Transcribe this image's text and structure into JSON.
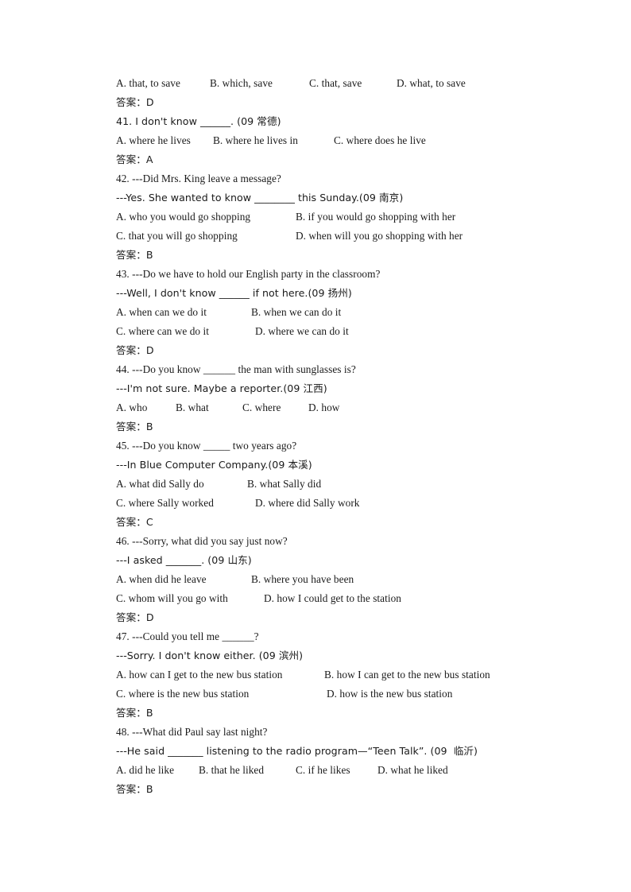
{
  "document": {
    "type": "english-grammar-worksheet",
    "answer_label": "答案：",
    "blank_short": "_____",
    "blank_medium": "______",
    "blank_long": "_______",
    "blank_xlong": "________"
  },
  "lead_options": {
    "a": "A. that, to save",
    "b": "B. which, save",
    "c": "C. that, save",
    "d": "D. what, to save",
    "answer": "答案：D"
  },
  "questions": [
    {
      "number": "41",
      "stem": "41. I don't know ______. (09 常德)",
      "stem_parts": {
        "prefix": "41. I don't know ",
        "blank": "______",
        "suffix": ". (09 常德)"
      },
      "sub_stem": null,
      "options_layout": "three-inline",
      "options": [
        "A. where he lives",
        "B. where he lives in",
        "C. where does he live"
      ],
      "answer": "答案：A"
    },
    {
      "number": "42",
      "stem": "42. ---Did Mrs. King leave a message?",
      "sub_stem": "---Yes. She wanted to know ________ this Sunday.(09 南京)",
      "sub_stem_parts": {
        "prefix": "---Yes. She wanted to know ",
        "blank": "________",
        "suffix": " this Sunday.(09 南京)"
      },
      "options_layout": "two-column-wide",
      "options": [
        "A. who you would go shopping",
        "B. if you would go shopping with her",
        "C. that you will go shopping",
        "D. when will you go shopping with her"
      ],
      "answer": "答案：B"
    },
    {
      "number": "43",
      "stem": "43. ---Do we have to hold our English party in the classroom?",
      "sub_stem": "---Well, I don't know ______ if not here.(09 扬州)",
      "sub_stem_parts": {
        "prefix": "---Well, I don't know ",
        "blank": "______",
        "suffix": " if not here.(09 扬州)"
      },
      "options_layout": "two-column-narrow",
      "options": [
        "A. when can we do it",
        "B. when we can do it",
        "C. where can we do it",
        "D. where we can do it"
      ],
      "answer": "答案：D"
    },
    {
      "number": "44",
      "stem": "44. ---Do you know ______ the man with sunglasses is?",
      "sub_stem": "---I'm not sure. Maybe a reporter.(09 江西)",
      "stem_parts": {
        "prefix": "44. ---Do you know ",
        "blank": "______",
        "suffix": " the man with sunglasses is?"
      },
      "options_layout": "four-inline",
      "options": [
        "A. who",
        "B. what",
        "C. where",
        "D. how"
      ],
      "answer": "答案：B"
    },
    {
      "number": "45",
      "stem": "45. ---Do you know _____ two years ago?",
      "sub_stem": "---In Blue Computer Company.(09 本溪)",
      "stem_parts": {
        "prefix": "45. ---Do you know ",
        "blank": "_____",
        "suffix": " two years ago?"
      },
      "options_layout": "two-column-narrow",
      "options": [
        "A. what did Sally do",
        "B. what Sally did",
        "C. where Sally worked",
        "D. where did Sally work"
      ],
      "answer": "答案：C"
    },
    {
      "number": "46",
      "stem": "46. ---Sorry, what did you say just now?",
      "sub_stem": "---I asked _______. (09 山东)",
      "sub_stem_parts": {
        "prefix": "---I asked ",
        "blank": "_______",
        "suffix": ". (09 山东)"
      },
      "options_layout": "two-column-narrow",
      "options": [
        "A. when did he leave",
        "B. where you have been",
        "C. whom will you go with",
        "D. how I could get to the station"
      ],
      "answer": "答案：D"
    },
    {
      "number": "47",
      "stem": "47. ---Could you tell me ______?",
      "sub_stem": "---Sorry. I don't know either. (09 滨州)",
      "stem_parts": {
        "prefix": "47. ---Could you tell me ",
        "blank": "______",
        "suffix": "?"
      },
      "options_layout": "two-column-wide",
      "options": [
        "A. how can I get to the new bus station",
        "B. how I can get to the new bus station",
        "C. where is the new bus station",
        "D. how is the new bus station"
      ],
      "answer": "答案：B"
    },
    {
      "number": "48",
      "stem": "48. ---What did Paul say last night?",
      "sub_stem": "---He said _______ listening to the radio program—“Teen Talk”. (09  临沂)",
      "sub_stem_parts": {
        "prefix": "---He said ",
        "blank": "_______",
        "suffix": " listening to the radio program—“Teen Talk”. (09  临沂)"
      },
      "options_layout": "four-inline",
      "options": [
        "A. did he like",
        "B. that he liked",
        "C. if he likes",
        "D. what he liked"
      ],
      "answer": "答案：B"
    }
  ]
}
